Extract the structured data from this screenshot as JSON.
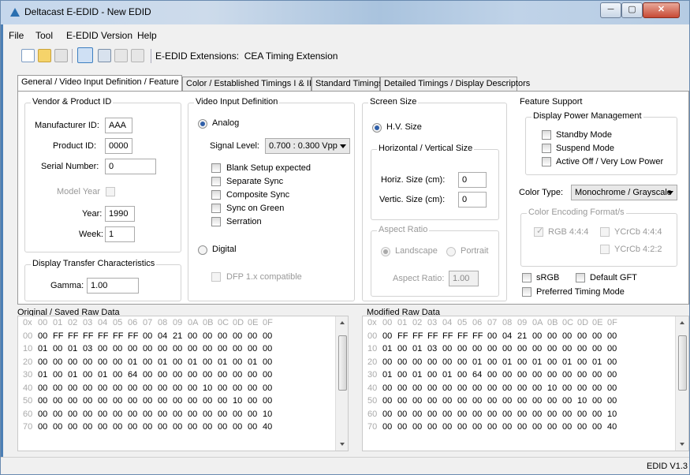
{
  "window": {
    "title": "Deltacast E-EDID - New EDID",
    "minimize": "─",
    "maximize": "▢",
    "close": "✕"
  },
  "menu": [
    "File",
    "Tool",
    "E-EDID Version",
    "Help"
  ],
  "toolbar": {
    "extensions_label": "E-EDID Extensions:",
    "extension_value": "CEA Timing Extension"
  },
  "tabs": [
    "General / Video Input Definition / Feature",
    "Color / Established Timings I & II",
    "Standard Timings",
    "Detailed Timings / Display Descriptors"
  ],
  "vendor": {
    "title": "Vendor & Product ID",
    "manufacturer_label": "Manufacturer ID:",
    "manufacturer": "AAA",
    "product_label": "Product ID:",
    "product": "0000",
    "serial_label": "Serial Number:",
    "serial": "0",
    "model_year_label": "Model Year",
    "year_label": "Year:",
    "year": "1990",
    "week_label": "Week:",
    "week": "1"
  },
  "transfer": {
    "title": "Display Transfer Characteristics",
    "gamma_label": "Gamma:",
    "gamma": "1.00"
  },
  "video": {
    "title": "Video Input Definition",
    "analog": "Analog",
    "signal_label": "Signal Level:",
    "signal_value": "0.700 : 0.300 Vpp",
    "checks": [
      "Blank Setup expected",
      "Separate Sync",
      "Composite Sync",
      "Sync on Green",
      "Serration"
    ],
    "digital": "Digital",
    "dfp": "DFP 1.x compatible"
  },
  "screen": {
    "title": "Screen Size",
    "hv": "H.V. Size",
    "hv_group": "Horizontal / Vertical Size",
    "horiz_label": "Horiz. Size (cm):",
    "horiz": "0",
    "vertic_label": "Vertic. Size (cm):",
    "vertic": "0",
    "aspect_title": "Aspect Ratio",
    "landscape": "Landscape",
    "portrait": "Portrait",
    "aspect_label": "Aspect Ratio:",
    "aspect": "1.00"
  },
  "feature": {
    "title": "Feature Support",
    "dpm_title": "Display Power Management",
    "standby": "Standby Mode",
    "suspend": "Suspend Mode",
    "active_off": "Active Off / Very Low Power",
    "color_type_label": "Color Type:",
    "color_type": "Monochrome / Grayscale",
    "encoding_title": "Color Encoding Format/s",
    "rgb444": "RGB 4:4:4",
    "ycrcb444": "YCrCb 4:4:4",
    "ycrcb422": "YCrCb 4:2:2",
    "srgb": "sRGB",
    "default_gft": "Default GFT",
    "preferred_timing": "Preferred Timing Mode"
  },
  "raw": {
    "original_title": "Original / Saved Raw Data",
    "modified_title": "Modified Raw Data",
    "corner": "0x",
    "columns": [
      "00",
      "01",
      "02",
      "03",
      "04",
      "05",
      "06",
      "07",
      "08",
      "09",
      "0A",
      "0B",
      "0C",
      "0D",
      "0E",
      "0F"
    ],
    "row_labels": [
      "00",
      "10",
      "20",
      "30",
      "40",
      "50",
      "60",
      "70"
    ],
    "original": [
      [
        "00",
        "FF",
        "FF",
        "FF",
        "FF",
        "FF",
        "FF",
        "00",
        "04",
        "21",
        "00",
        "00",
        "00",
        "00",
        "00",
        "00"
      ],
      [
        "01",
        "00",
        "01",
        "03",
        "00",
        "00",
        "00",
        "00",
        "00",
        "00",
        "00",
        "00",
        "00",
        "00",
        "00",
        "00"
      ],
      [
        "00",
        "00",
        "00",
        "00",
        "00",
        "00",
        "01",
        "00",
        "01",
        "00",
        "01",
        "00",
        "01",
        "00",
        "01",
        "00"
      ],
      [
        "01",
        "00",
        "01",
        "00",
        "01",
        "00",
        "64",
        "00",
        "00",
        "00",
        "00",
        "00",
        "00",
        "00",
        "00",
        "00"
      ],
      [
        "00",
        "00",
        "00",
        "00",
        "00",
        "00",
        "00",
        "00",
        "00",
        "00",
        "00",
        "10",
        "00",
        "00",
        "00",
        "00"
      ],
      [
        "00",
        "00",
        "00",
        "00",
        "00",
        "00",
        "00",
        "00",
        "00",
        "00",
        "00",
        "00",
        "00",
        "10",
        "00",
        "00"
      ],
      [
        "00",
        "00",
        "00",
        "00",
        "00",
        "00",
        "00",
        "00",
        "00",
        "00",
        "00",
        "00",
        "00",
        "00",
        "00",
        "10"
      ],
      [
        "00",
        "00",
        "00",
        "00",
        "00",
        "00",
        "00",
        "00",
        "00",
        "00",
        "00",
        "00",
        "00",
        "00",
        "00",
        "40"
      ]
    ],
    "modified": [
      [
        "00",
        "FF",
        "FF",
        "FF",
        "FF",
        "FF",
        "FF",
        "00",
        "04",
        "21",
        "00",
        "00",
        "00",
        "00",
        "00",
        "00"
      ],
      [
        "01",
        "00",
        "01",
        "03",
        "00",
        "00",
        "00",
        "00",
        "00",
        "00",
        "00",
        "00",
        "00",
        "00",
        "00",
        "00"
      ],
      [
        "00",
        "00",
        "00",
        "00",
        "00",
        "00",
        "01",
        "00",
        "01",
        "00",
        "01",
        "00",
        "01",
        "00",
        "01",
        "00"
      ],
      [
        "01",
        "00",
        "01",
        "00",
        "01",
        "00",
        "64",
        "00",
        "00",
        "00",
        "00",
        "00",
        "00",
        "00",
        "00",
        "00"
      ],
      [
        "00",
        "00",
        "00",
        "00",
        "00",
        "00",
        "00",
        "00",
        "00",
        "00",
        "00",
        "10",
        "00",
        "00",
        "00",
        "00"
      ],
      [
        "00",
        "00",
        "00",
        "00",
        "00",
        "00",
        "00",
        "00",
        "00",
        "00",
        "00",
        "00",
        "00",
        "10",
        "00",
        "00"
      ],
      [
        "00",
        "00",
        "00",
        "00",
        "00",
        "00",
        "00",
        "00",
        "00",
        "00",
        "00",
        "00",
        "00",
        "00",
        "00",
        "10"
      ],
      [
        "00",
        "00",
        "00",
        "00",
        "00",
        "00",
        "00",
        "00",
        "00",
        "00",
        "00",
        "00",
        "00",
        "00",
        "00",
        "40"
      ]
    ]
  },
  "status": {
    "version": "EDID V1.3"
  }
}
